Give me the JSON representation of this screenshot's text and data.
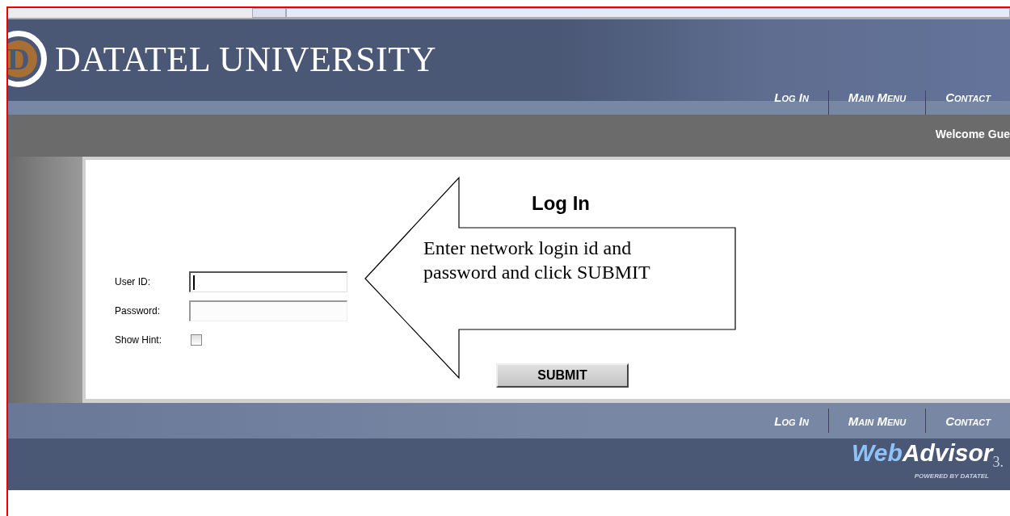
{
  "header": {
    "title": "DATATEL UNIVERSITY",
    "logo_letter": "D"
  },
  "top_nav": [
    {
      "label": "Log In"
    },
    {
      "label": "Main Menu"
    },
    {
      "label": "Contact"
    }
  ],
  "welcome": "Welcome Gue",
  "login": {
    "title": "Log In",
    "fields": [
      {
        "kind": "text",
        "label": "User ID:",
        "focused": true
      },
      {
        "kind": "text",
        "label": "Password:",
        "focused": false
      },
      {
        "kind": "checkbox",
        "label": "Show Hint:",
        "checked": false
      }
    ],
    "submit": "SUBMIT"
  },
  "callout": {
    "text": "Enter network login id and password and click SUBMIT"
  },
  "bottom_nav": [
    {
      "label": "Log In"
    },
    {
      "label": "Main Menu"
    },
    {
      "label": "Contact"
    }
  ],
  "footer_logo": {
    "web": "Web",
    "advisor": "Advisor",
    "version": "3.",
    "tagline": "POWERED BY DATATEL"
  }
}
